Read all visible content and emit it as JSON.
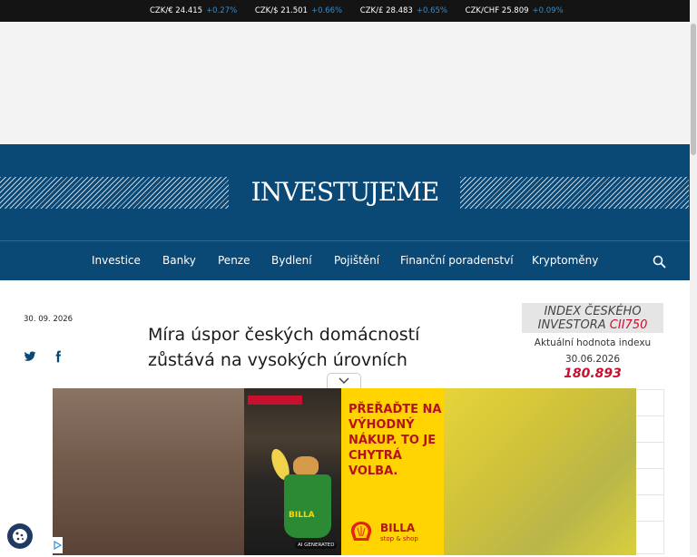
{
  "ticker": [
    {
      "pair": "CZK/€ 24.415",
      "change": "+0.27%"
    },
    {
      "pair": "CZK/$ 21.501",
      "change": "+0.66%"
    },
    {
      "pair": "CZK/£ 28.483",
      "change": "+0.65%"
    },
    {
      "pair": "CZK/CHF 25.809",
      "change": "+0.09%"
    }
  ],
  "brand": {
    "logo": "INVESTUJEME"
  },
  "nav": {
    "items": [
      "Investice",
      "Banky",
      "Penze",
      "Bydlení",
      "Pojištění",
      "Finanční poradenství",
      "Kryptoměny"
    ],
    "search_icon": "search-icon"
  },
  "article": {
    "date": "30. 09. 2026",
    "headline": "Míra úspor českých domácností zůstává na vysokých úrovních",
    "share_icons": [
      "twitter-icon",
      "facebook-icon"
    ]
  },
  "index_widget": {
    "title": "INDEX ČESKÉHO INVESTORA",
    "code": "CII750",
    "label": "Aktuální hodnota indexu",
    "date": "30.06.2026",
    "value": "180.893"
  },
  "ad": {
    "slogan": "PŘEŘAĎTE NA VÝHODNÝ NÁKUP. TO JE CHYTRÁ VOLBA.",
    "brand": "BILLA",
    "brand_sub": "stop & shop",
    "bag_label": "BILLA",
    "ai_badge": "AI GENERATED"
  },
  "colors": {
    "masthead": "#0a4876",
    "ticker_bg": "#141414",
    "ticker_change": "#2d8fd6",
    "index_accent": "#c8102e",
    "ad_yellow": "#ffd400"
  }
}
